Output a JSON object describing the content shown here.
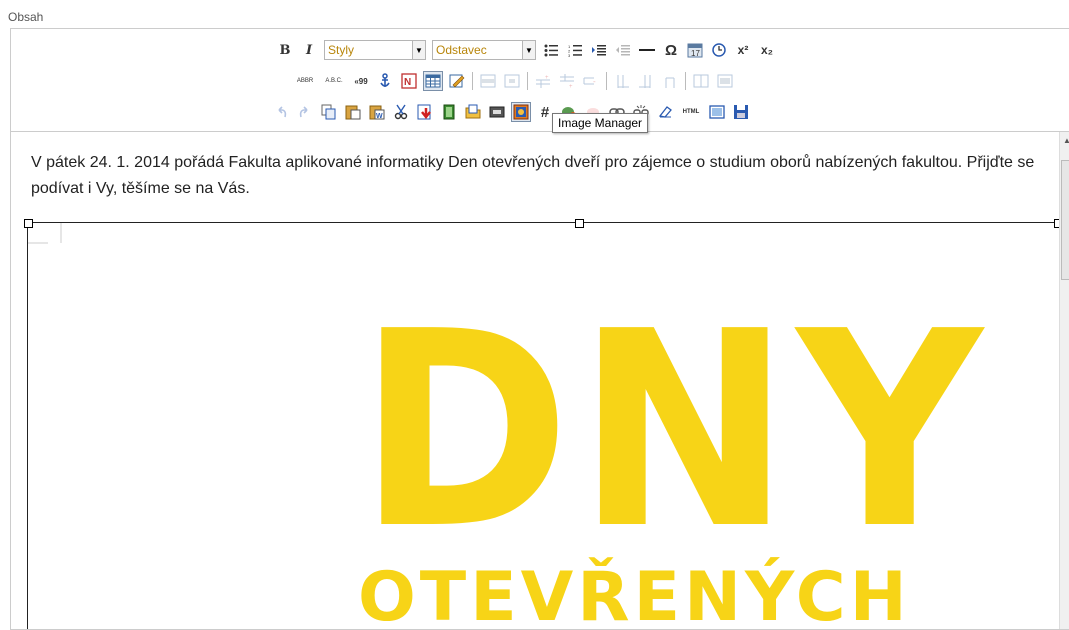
{
  "field_label": "Obsah",
  "toolbar": {
    "styles_select": "Styly",
    "format_select": "Odstavec",
    "bold": "B",
    "italic": "I",
    "abbr": "ABBR",
    "acronym": "A.B.C.",
    "quote": "«99",
    "hash": "#",
    "html": "HTML",
    "superscript": "x²",
    "subscript": "x₂",
    "omega": "Ω"
  },
  "tooltip": "Image Manager",
  "content": {
    "paragraph": "V pátek 24. 1. 2014 pořádá Fakulta aplikované informatiky Den otevřených dveří pro zájemce o studium oborů nabízených fakultou. Přijďte se podívat i Vy, těšíme se na Vás.",
    "image_text_line1": "DNY",
    "image_text_line2": "OTEVŘENÝCH"
  },
  "colors": {
    "accent_yellow": "#f7d417",
    "toolbar_text": "#b8860b"
  }
}
